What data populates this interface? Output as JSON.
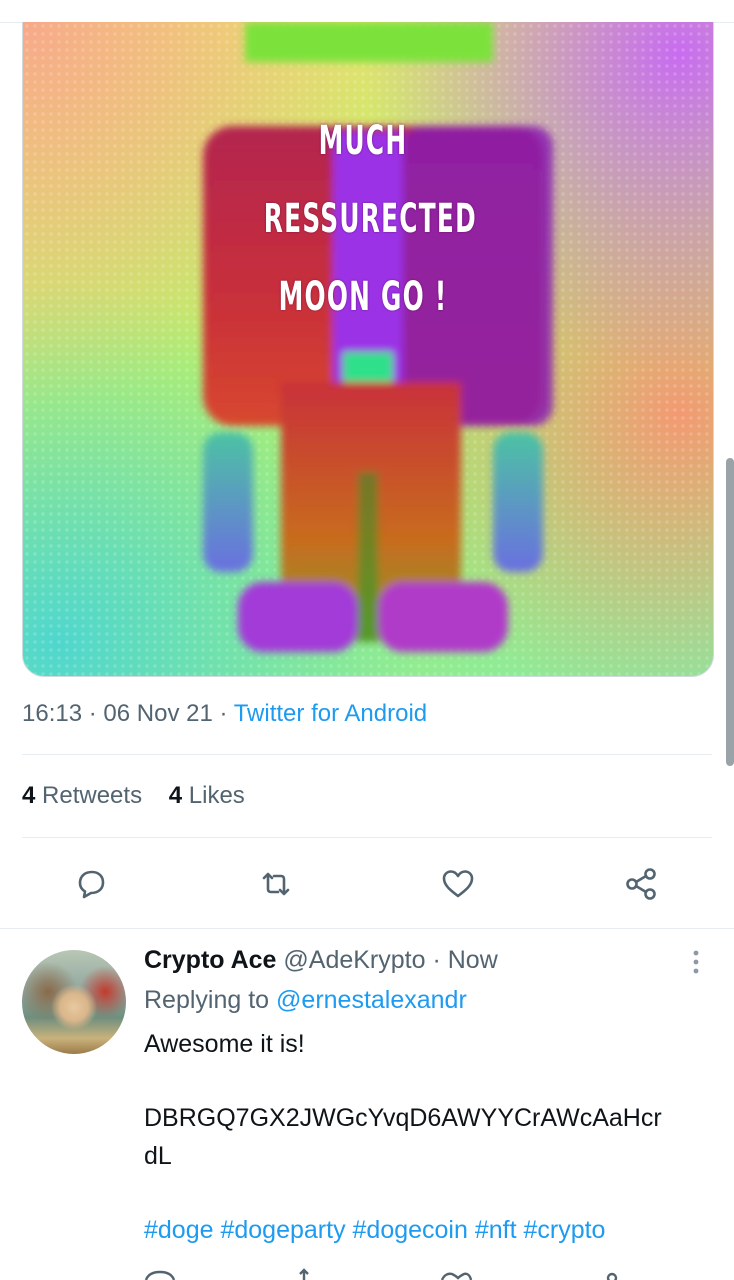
{
  "media": {
    "meme_lines": [
      "MUCH",
      "RESSURECTED",
      "MOON GO !"
    ]
  },
  "tweet_meta": {
    "time": "16:13",
    "date": "06 Nov 21",
    "separator": "·",
    "source": "Twitter for Android"
  },
  "stats": {
    "retweets_count": "4",
    "retweets_label": "Retweets",
    "likes_count": "4",
    "likes_label": "Likes"
  },
  "actions": [
    "reply-icon",
    "retweet-icon",
    "like-icon",
    "share-icon"
  ],
  "reply": {
    "name": "Crypto Ace",
    "handle": "@AdeKrypto",
    "separator": "·",
    "time": "Now",
    "replying_prefix": "Replying to",
    "replying_to": "@ernestalexandr",
    "line1": "Awesome it is!",
    "line2": "DBRGQ7GX2JWGcYvqD6AWYYCrAWcAaHcr",
    "line3": "dL",
    "hashtags": "#doge #dogeparty #dogecoin #nft #crypto"
  },
  "colors": {
    "link": "#1d9bf0",
    "muted": "#536471",
    "text": "#0f1419"
  }
}
